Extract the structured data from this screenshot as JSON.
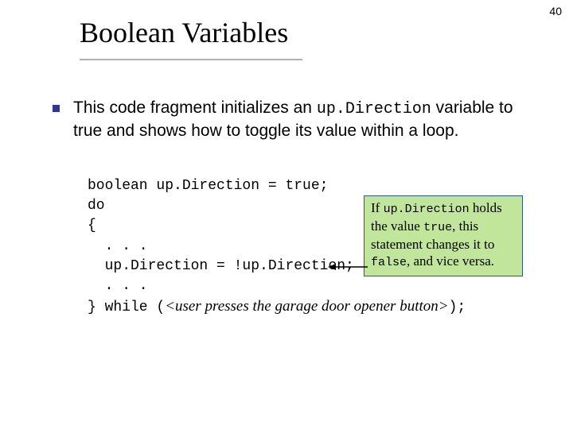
{
  "page_number": "40",
  "title": "Boolean Variables",
  "body": {
    "pre": "This code fragment initializes an ",
    "code_var": "up.Direction",
    "post": " variable to true and shows how to toggle its value within a loop."
  },
  "code": {
    "l1": "boolean up.Direction = true;",
    "l2": "do",
    "l3": "{",
    "l4": "  . . .",
    "l5": "  up.Direction = !up.Direction;",
    "l6": "  . . .",
    "l7a": "} while (",
    "l7b": "<user presses the garage door opener button>",
    "l7c": ");"
  },
  "callout": {
    "p1": "If ",
    "c1": "up.Direction",
    "p2": " holds the value ",
    "c2": "true",
    "p3": ", this statement changes it to ",
    "c3": "false",
    "p4": ", and vice versa."
  }
}
